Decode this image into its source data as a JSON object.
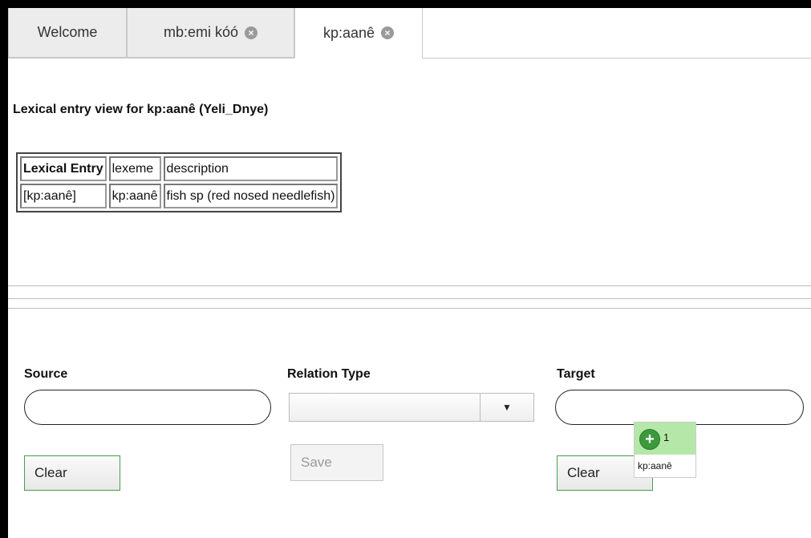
{
  "tabs": [
    {
      "label": "Welcome",
      "closable": false,
      "active": false
    },
    {
      "label": "mb:emi kóó",
      "closable": true,
      "active": false
    },
    {
      "label": "kp:aanê",
      "closable": true,
      "active": true
    }
  ],
  "view": {
    "title": "Lexical entry view for kp:aanê (Yeli_Dnye)"
  },
  "table": {
    "headers": [
      "Lexical Entry",
      "lexeme",
      "description"
    ],
    "rows": [
      [
        "[kp:aanê]",
        "kp:aanê",
        "fish sp (red nosed needlefish)"
      ]
    ]
  },
  "relation_form": {
    "source_label": "Source",
    "relation_type_label": "Relation Type",
    "target_label": "Target",
    "source_value": "",
    "target_value": "",
    "relation_type_value": "",
    "clear_label": "Clear",
    "save_label": "Save"
  },
  "drag_proxy": {
    "count": "1",
    "label": "kp:aanê"
  },
  "colors": {
    "accent_green": "#4f9a4f",
    "drag_bg": "#b5e8a8"
  }
}
